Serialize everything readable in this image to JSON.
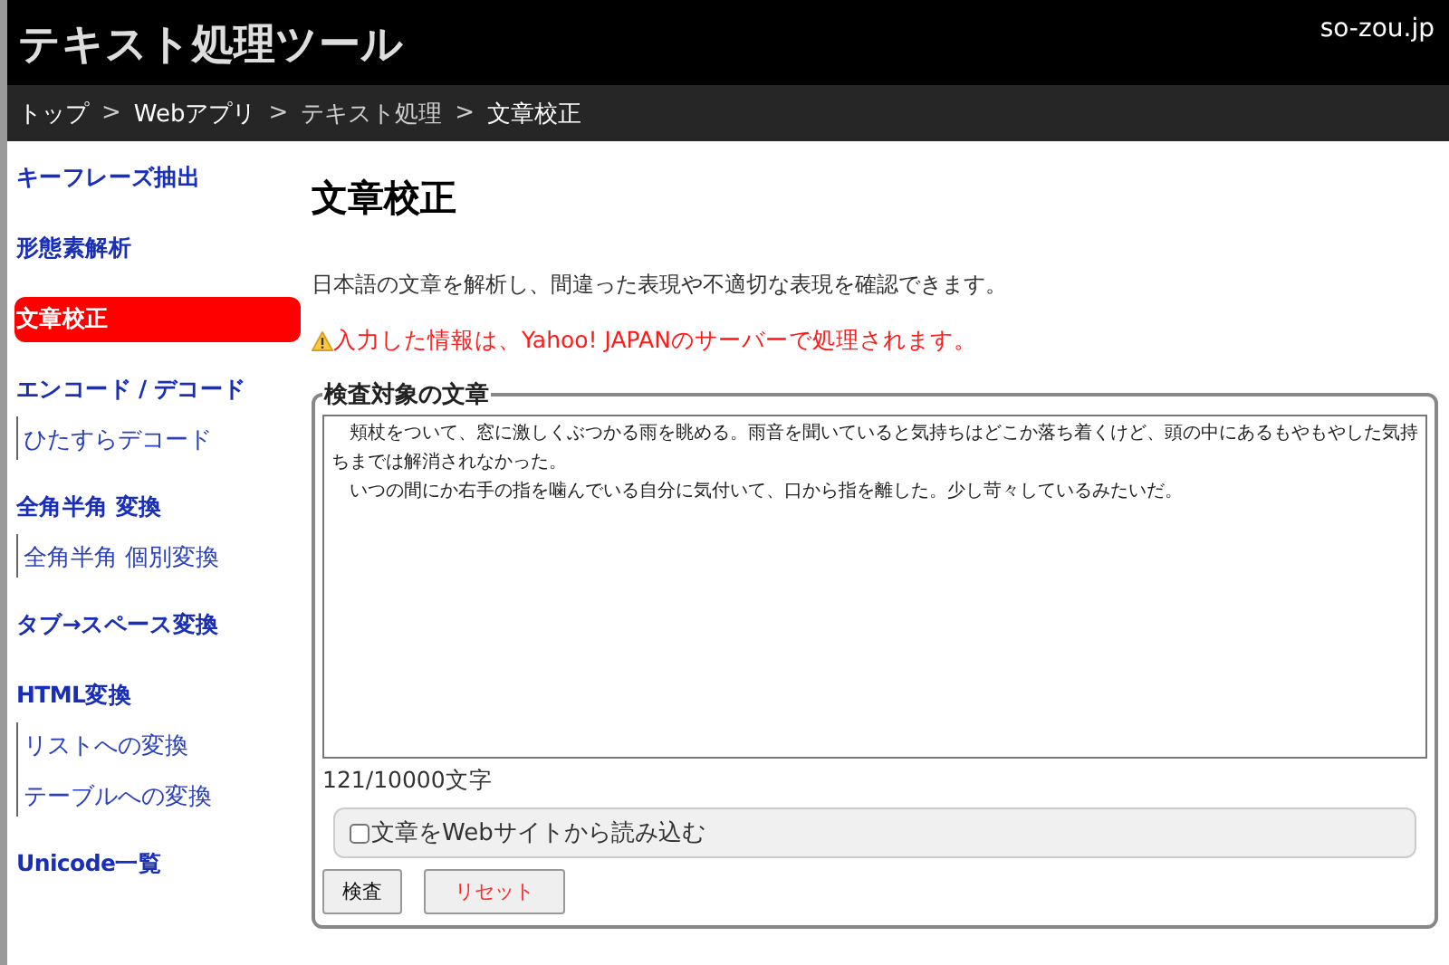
{
  "header": {
    "title": "テキスト処理ツール",
    "site": "so-zou.jp"
  },
  "breadcrumb": [
    {
      "label": "トップ",
      "link": true,
      "separator": ">"
    },
    {
      "label": "Webアプリ",
      "link": true,
      "separator": ">"
    },
    {
      "label": "テキスト処理",
      "link": false,
      "separator": ">"
    },
    {
      "label": "文章校正",
      "link": true
    }
  ],
  "sidebar": {
    "items": [
      {
        "label": "キーフレーズ抽出",
        "selected": false
      },
      {
        "label": "形態素解析",
        "selected": false
      },
      {
        "label": "文章校正",
        "selected": true
      },
      {
        "label": "エンコード / デコード",
        "selected": false,
        "children": [
          {
            "label": "ひたすらデコード"
          }
        ]
      },
      {
        "label": "全角半角 変換",
        "selected": false,
        "children": [
          {
            "label": "全角半角 個別変換"
          }
        ]
      },
      {
        "label": "タブ→スペース変換",
        "selected": false
      },
      {
        "label": "HTML変換",
        "selected": false,
        "children": [
          {
            "label": "リストへの変換"
          },
          {
            "label": "テーブルへの変換"
          }
        ]
      },
      {
        "label": "Unicode一覧",
        "selected": false
      }
    ]
  },
  "main": {
    "heading": "文章校正",
    "description": "日本語の文章を解析し、間違った表現や不適切な表現を確認できます。",
    "warning": "入力した情報は、Yahoo! JAPANのサーバーで処理されます。",
    "form": {
      "legend": "検査対象の文章",
      "paragraphs": [
        "頬杖をついて、窓に激しくぶつかる雨を眺める。雨音を聞いていると気持ちはどこか落ち着くけど、頭の中にあるもやもやした気持ちまでは解消されなかった。",
        "いつの間にか右手の指を噛んでいる自分に気付いて、口から指を離した。少し苛々しているみたいだ。"
      ],
      "count": "121/10000文字",
      "load_option": {
        "label": "文章をWebサイトから読み込む",
        "checked": false
      },
      "buttons": [
        {
          "label": "検査",
          "kind": "submit"
        },
        {
          "label": "リセット",
          "kind": "reset"
        }
      ]
    }
  }
}
